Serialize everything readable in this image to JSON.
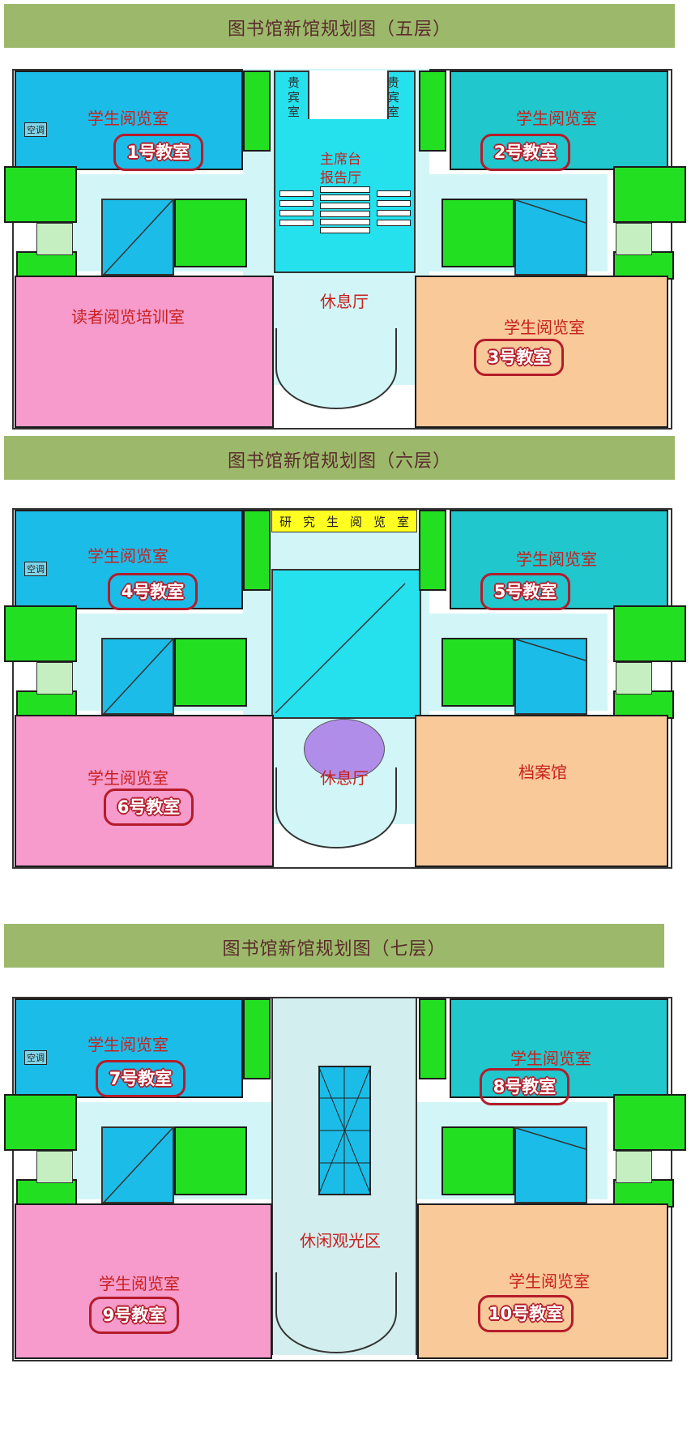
{
  "floors": [
    {
      "title": "图书馆新馆规划图（五层）",
      "rooms": {
        "top_left": "学生阅览室",
        "top_right": "学生阅览室",
        "bottom_left": "读者阅览培训室",
        "bottom_right": "学生阅览室",
        "center_bottom": "休息厅",
        "center_top_line1": "主席台",
        "center_top_line2": "报告厅",
        "vip_left": "贵宾室",
        "vip_right": "贵宾室",
        "ac": "空调"
      },
      "badges": {
        "top_left": "1号教室",
        "top_right": "2号教室",
        "bottom_right": "3号教室"
      }
    },
    {
      "title": "图书馆新馆规划图（六层）",
      "rooms": {
        "top_left": "学生阅览室",
        "top_right": "学生阅览室",
        "bottom_left": "学生阅览室",
        "bottom_right": "档案馆",
        "center_bottom": "休息厅",
        "grad_chars": [
          "研",
          "究",
          "生",
          "阅",
          "览",
          "室"
        ],
        "ac": "空调"
      },
      "badges": {
        "top_left": "4号教室",
        "top_right": "5号教室",
        "bottom_left": "6号教室"
      }
    },
    {
      "title": "图书馆新馆规划图（七层）",
      "rooms": {
        "top_left": "学生阅览室",
        "top_right": "学生阅览室",
        "bottom_left": "学生阅览室",
        "bottom_right": "学生阅览室",
        "center": "休闲观光区",
        "ac": "空调"
      },
      "badges": {
        "top_left": "7号教室",
        "top_right": "8号教室",
        "bottom_left": "9号教室",
        "bottom_right": "10号教室"
      }
    }
  ],
  "colors": {
    "banner": "#9cb96b",
    "reading_blue": "#1bbde8",
    "reading_teal": "#20c7cc",
    "training_pink": "#f69bcb",
    "archive_peach": "#f9c99a",
    "restroom_green": "#22e021",
    "corridor": "#d2f6f7",
    "graduate_yellow": "#ffff22",
    "label_red": "#c8201f"
  }
}
